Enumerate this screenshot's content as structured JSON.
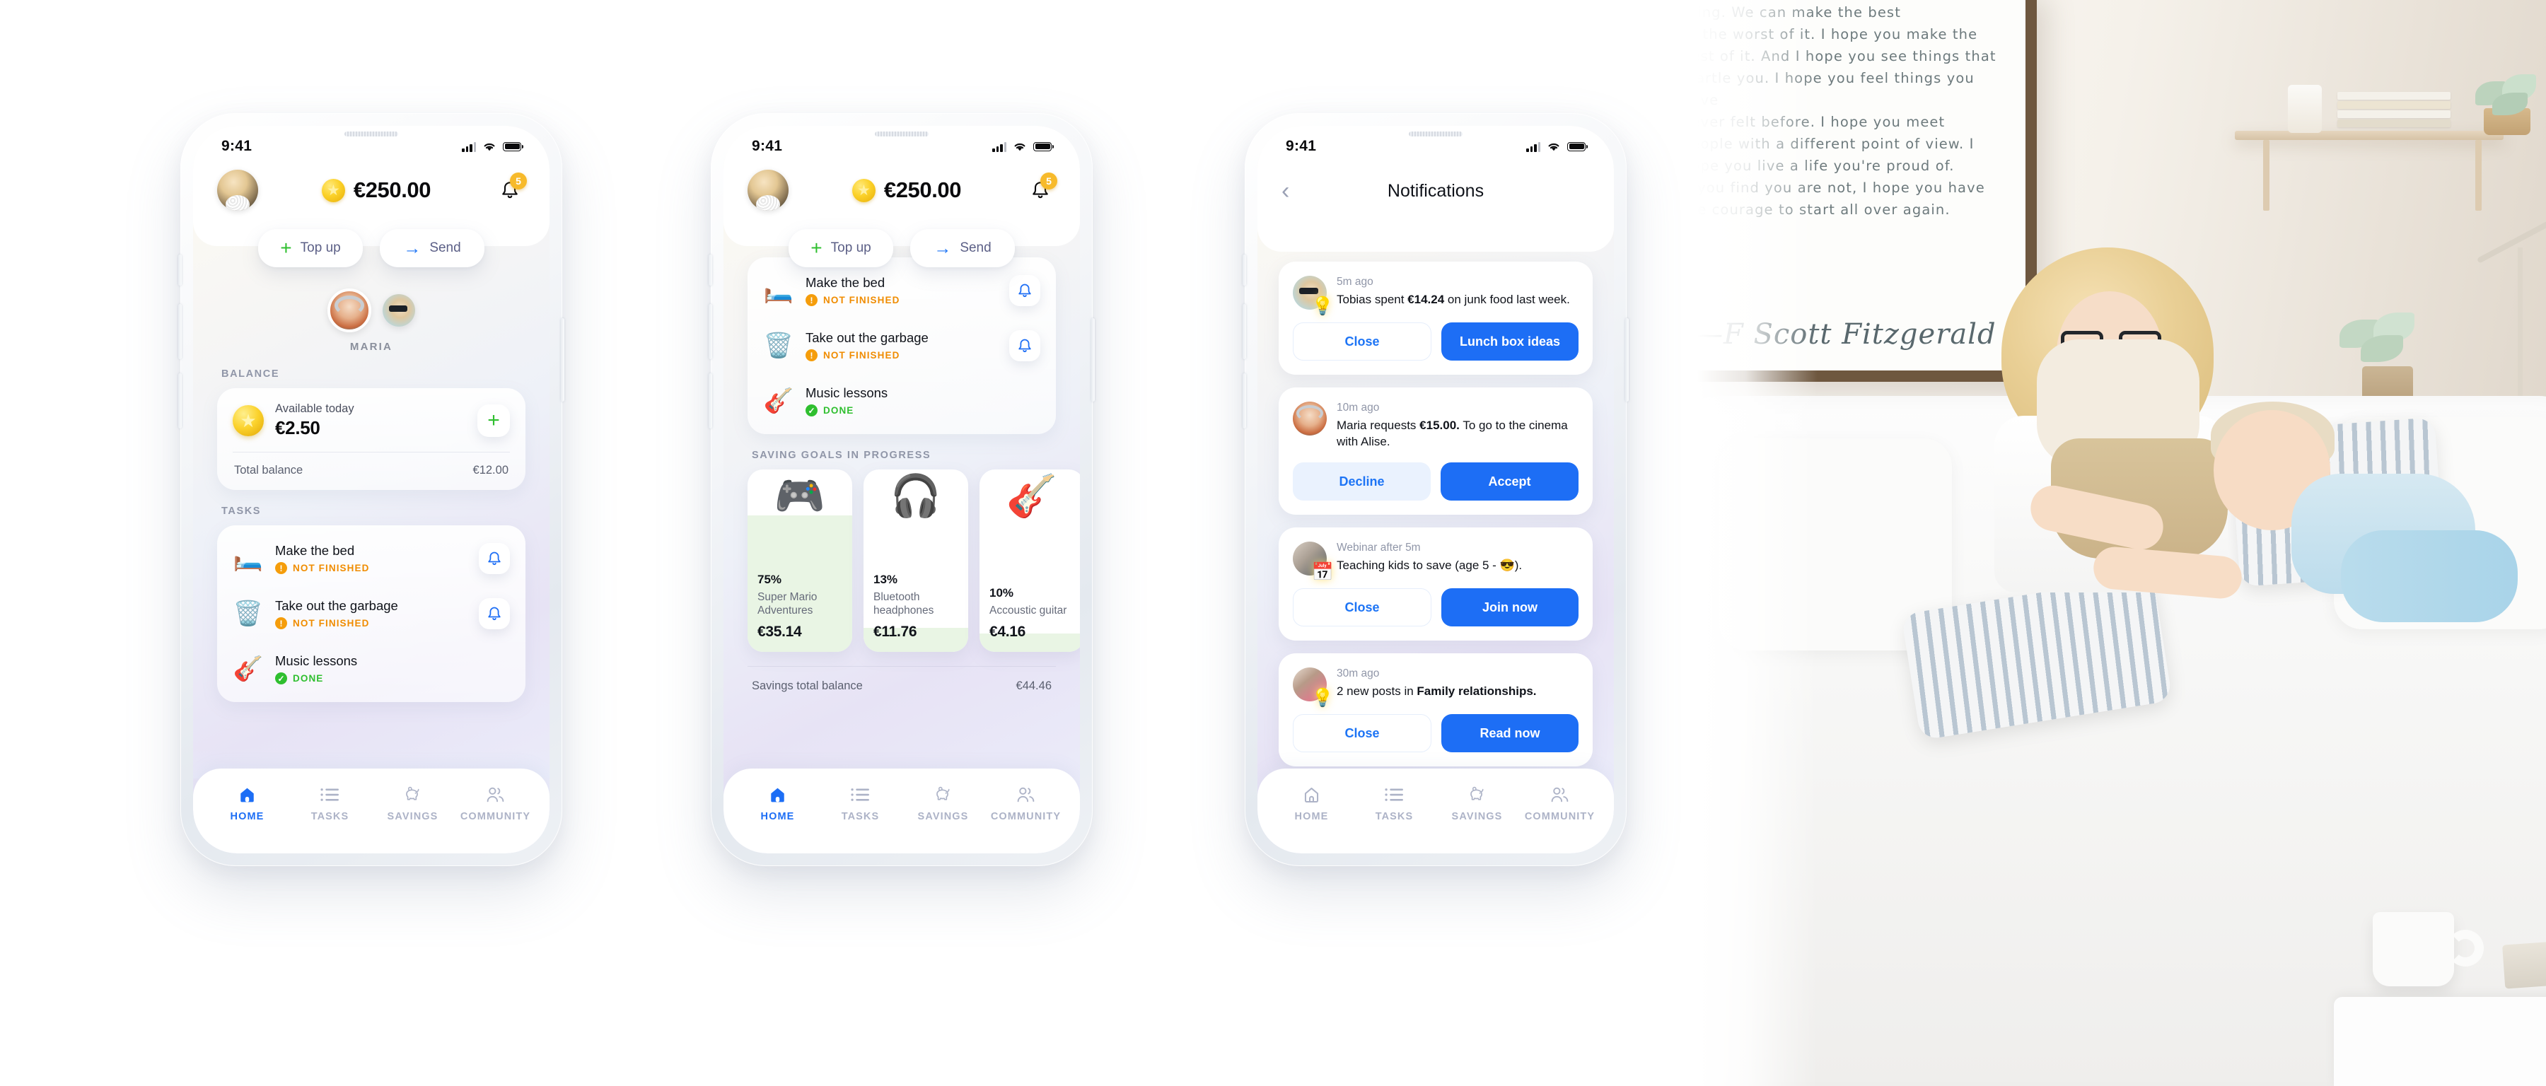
{
  "status_bar": {
    "time": "9:41"
  },
  "header": {
    "balance": "€250.00",
    "coin_icon": "★",
    "notification_count": "5"
  },
  "actions": {
    "top_up": "Top up",
    "send": "Send"
  },
  "family": {
    "selected_name": "MARIA",
    "members": [
      "Maria",
      "Tobias"
    ]
  },
  "balance_section": {
    "title": "BALANCE",
    "available_label": "Available today",
    "available_value": "€2.50",
    "total_label": "Total balance",
    "total_value": "€12.00",
    "add_icon": "+"
  },
  "tasks_section": {
    "title": "TASKS",
    "items": [
      {
        "emoji": "🛏️",
        "name": "Make the bed",
        "status": "NOT FINISHED",
        "state": "warn"
      },
      {
        "emoji": "🗑️",
        "name": "Take out the garbage",
        "status": "NOT FINISHED",
        "state": "warn"
      },
      {
        "emoji": "🎸",
        "name": "Music lessons",
        "status": "DONE",
        "state": "ok"
      }
    ]
  },
  "savings_section": {
    "title": "SAVING GOALS IN PROGRESS",
    "total_label": "Savings total balance",
    "total_value": "€44.46",
    "goals": [
      {
        "emoji": "🎮",
        "percent": "75%",
        "percent_value": 75,
        "name": "Super Mario Adventures",
        "amount": "€35.14"
      },
      {
        "emoji": "🎧",
        "percent": "13%",
        "percent_value": 13,
        "name": "Bluetooth headphones",
        "amount": "€11.76"
      },
      {
        "emoji": "🎸",
        "percent": "10%",
        "percent_value": 10,
        "name": "Accoustic guitar",
        "amount": "€4.16"
      }
    ]
  },
  "notifications_screen": {
    "title": "Notifications",
    "back_icon": "‹",
    "items": [
      {
        "time": "5m ago",
        "message_pre": "Tobias spent ",
        "message_bold": "€14.24",
        "message_post": " on junk food last week.",
        "deco": "💡",
        "avatar": "av-tobias",
        "primary": "Lunch box ideas",
        "secondary": "Close",
        "secondary_style": "ghost"
      },
      {
        "time": "10m ago",
        "message_pre": "Maria requests ",
        "message_bold": "€15.00.",
        "message_post": " To go to the cinema with Alise.",
        "deco": "",
        "avatar": "av-maria",
        "primary": "Accept",
        "secondary": "Decline",
        "secondary_style": "soft"
      },
      {
        "time": "Webinar after 5m",
        "message_pre": "Teaching kids to save (age 5 - 😎).",
        "message_bold": "",
        "message_post": "",
        "deco": "📅",
        "avatar": "av-webinar",
        "primary": "Join now",
        "secondary": "Close",
        "secondary_style": "ghost"
      },
      {
        "time": "30m ago",
        "message_pre": "2 new posts in ",
        "message_bold": "Family relationships.",
        "message_post": "",
        "deco": "💡",
        "avatar": "av-family",
        "primary": "Read now",
        "secondary": "Close",
        "secondary_style": "ghost"
      }
    ]
  },
  "bottom_nav": {
    "items": [
      {
        "icon": "home-icon",
        "label": "HOME"
      },
      {
        "icon": "list-icon",
        "label": "TASKS"
      },
      {
        "icon": "piggy-bank-icon",
        "label": "SAVINGS"
      },
      {
        "icon": "community-icon",
        "label": "COMMUNITY"
      }
    ],
    "active_index_phone1": 0,
    "active_index_phone2": 0
  },
  "photo": {
    "poster_quote": "thing. We can make the best\nor the worst of it. I hope you make the\nbest of it. And I hope you see things that\nstartle you. I hope you feel things you have\nnever felt before. I hope you meet\npeople with a different point of view. I\nhope you live a life you're proud of.\nIf you find you are not, I hope you have\nthe courage to start all over again.",
    "poster_author": "—F Scott Fitzgerald"
  },
  "colors": {
    "accent_blue": "#1d6ef5",
    "link_blue": "#1d74f5",
    "green": "#2fbf2f",
    "warn_orange": "#f08c00",
    "badge_yellow": "#f7ba2b",
    "nav_inactive": "#adb3c7"
  }
}
